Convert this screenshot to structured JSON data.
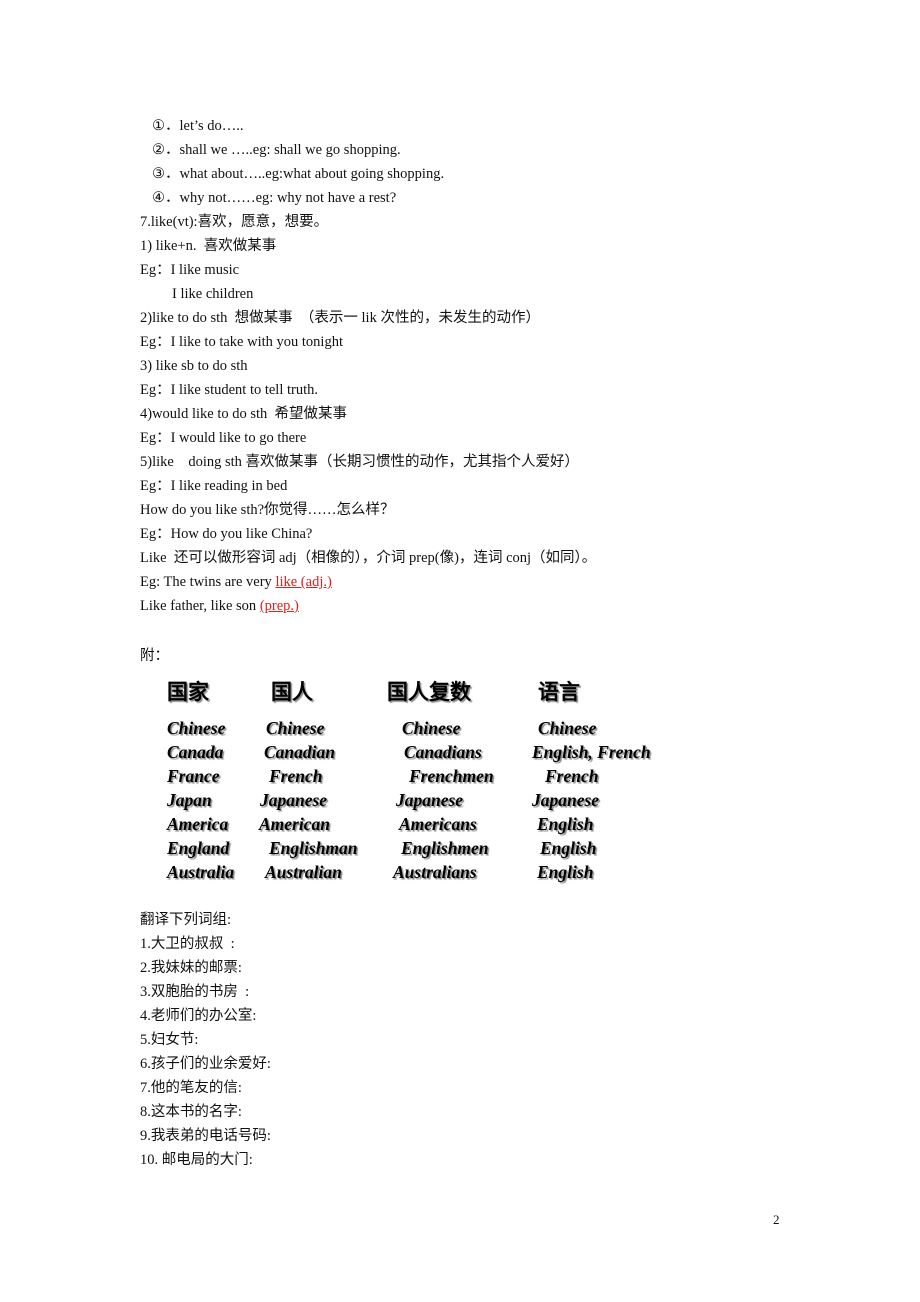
{
  "suggestions": [
    {
      "marker": "①．",
      "text": "let’s do….."
    },
    {
      "marker": "②．",
      "text": "shall we …..eg: shall we go shopping."
    },
    {
      "marker": "③．",
      "text": "what about…..eg:what about going shopping."
    },
    {
      "marker": "④．",
      "text": "why not……eg: why not have a rest?"
    }
  ],
  "like_section": {
    "heading": "7.like(vt):喜欢，愿意，想要。",
    "lines": [
      "1) like+n.  喜欢做某事",
      "Eg：I like music",
      "I like children",
      "2)like to do sth  想做某事  （表示一 lik 次性的，未发生的动作）",
      "Eg：I like to take with you tonight",
      "3) like sb to do sth",
      "Eg：I like student to tell truth.",
      "4)would like to do sth  希望做某事",
      "Eg：I would like to go there",
      "5)like    doing sth 喜欢做某事（长期习惯性的动作，尤其指个人爱好）",
      "Eg：I like reading in bed",
      "How do you like sth?你觉得……怎么样？",
      "Eg：How do you like China?",
      "Like  还可以做形容词 adj（相像的），介词 prep(像)，连词 conj（如同）。"
    ],
    "example_adj": {
      "prefix": "Eg: The twins are very ",
      "highlight": "like (adj.)"
    },
    "example_prep": {
      "prefix": "Like father, like son ",
      "highlight": "(prep.)"
    },
    "highlight_color": "#e0201c"
  },
  "appendix": {
    "label": "附：",
    "table": {
      "headers": [
        "国家",
        "国人",
        "国人复数",
        "语言"
      ],
      "rows": [
        [
          "Chinese",
          "Chinese",
          "Chinese",
          "Chinese"
        ],
        [
          "Canada",
          "Canadian",
          "Canadians",
          "English, French"
        ],
        [
          "France",
          "French",
          "Frenchmen",
          "French"
        ],
        [
          "Japan",
          "Japanese",
          "Japanese",
          "Japanese"
        ],
        [
          "America",
          "American",
          "Americans",
          "English"
        ],
        [
          "England",
          "Englishman",
          "Englishmen",
          "English"
        ],
        [
          "Australia",
          "Australian",
          "Australians",
          "English"
        ]
      ]
    }
  },
  "exercise": {
    "title": "翻译下列词组:",
    "items": [
      "1.大卫的叔叔  :",
      "2.我妹妹的邮票:",
      "3.双胞胎的书房  :",
      "4.老师们的办公室:",
      "5.妇女节:",
      "6.孩子们的业余爱好:",
      "7.他的笔友的信:",
      "8.这本书的名字:",
      "9.我表弟的电话号码:",
      "10. 邮电局的大门:"
    ]
  },
  "page_number": "2"
}
